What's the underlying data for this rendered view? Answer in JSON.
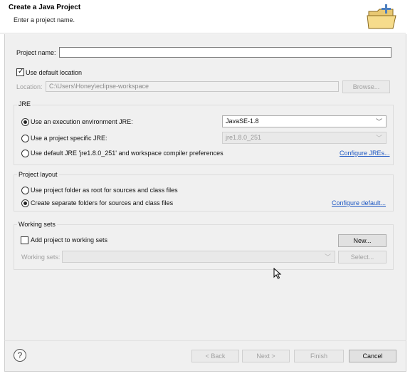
{
  "header": {
    "title": "Create a Java Project",
    "subtitle": "Enter a project name."
  },
  "project": {
    "name_label": "Project name:",
    "name_value": "",
    "use_default_label": "Use default location",
    "use_default_checked": true,
    "location_label": "Location:",
    "location_value": "C:\\Users\\Honey\\eclipse-workspace",
    "browse_label": "Browse..."
  },
  "jre": {
    "group_title": "JRE",
    "option_env_label": "Use an execution environment JRE:",
    "option_env_value": "JavaSE-1.8",
    "option_specific_label": "Use a project specific JRE:",
    "option_specific_value": "jre1.8.0_251",
    "option_default_label": "Use default JRE 'jre1.8.0_251' and workspace compiler preferences",
    "configure_link": "Configure JREs..."
  },
  "layout": {
    "group_title": "Project layout",
    "option_root_label": "Use project folder as root for sources and class files",
    "option_separate_label": "Create separate folders for sources and class files",
    "configure_link": "Configure default..."
  },
  "working_sets": {
    "group_title": "Working sets",
    "add_label": "Add project to working sets",
    "add_checked": false,
    "new_label": "New...",
    "sets_label": "Working sets:",
    "sets_value": "",
    "select_label": "Select..."
  },
  "footer": {
    "help_symbol": "?",
    "back_label": "< Back",
    "next_label": "Next >",
    "finish_label": "Finish",
    "cancel_label": "Cancel"
  },
  "icons": {
    "header_icon": "new-java-project-folder-icon",
    "help_icon": "help-icon",
    "cursor": "mouse-pointer"
  }
}
